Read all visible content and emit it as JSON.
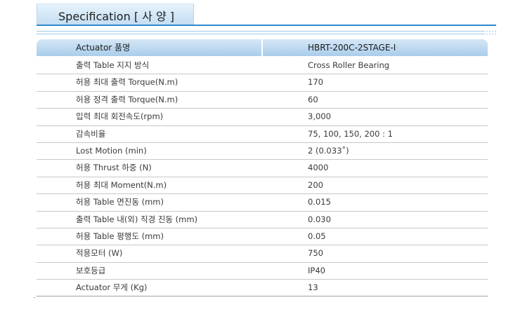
{
  "section": {
    "title": "Specification  [ 사 양 ]"
  },
  "table": {
    "header": {
      "label": "Actuator 품명",
      "value": "HBRT-200C-2STAGE-I"
    },
    "rows": [
      {
        "label": "출력 Table 지지 방식",
        "value": "Cross Roller Bearing"
      },
      {
        "label": "허용 최대 출력 Torque(N.m)",
        "value": "170"
      },
      {
        "label": "허용 정격 출력 Torque(N.m)",
        "value": "60"
      },
      {
        "label": "입력 최대 회전속도(rpm)",
        "value": "3,000"
      },
      {
        "label": "감속비율",
        "value": "75, 100, 150, 200 : 1"
      },
      {
        "label": "Lost Motion (min)",
        "value": "2 (0.033˚)"
      },
      {
        "label": "허용 Thrust 하중 (N)",
        "value": "4000"
      },
      {
        "label": "허용 최대  Moment(N.m)",
        "value": "200"
      },
      {
        "label": "허용 Table 면진동 (mm)",
        "value": "0.015"
      },
      {
        "label": "출력 Table 내(외) 직경 진동 (mm)",
        "value": "0.030"
      },
      {
        "label": "허용 Table 평행도 (mm)",
        "value": "0.05"
      },
      {
        "label": "적용모터 (W)",
        "value": "750"
      },
      {
        "label": "보호등급",
        "value": "IP40"
      },
      {
        "label": "Actuator 무게 (Kg)",
        "value": "13"
      }
    ]
  },
  "colors": {
    "accent": "#2f88cd",
    "header_fill": "#bcd9f0",
    "row_divider": "#c8c8c8"
  }
}
